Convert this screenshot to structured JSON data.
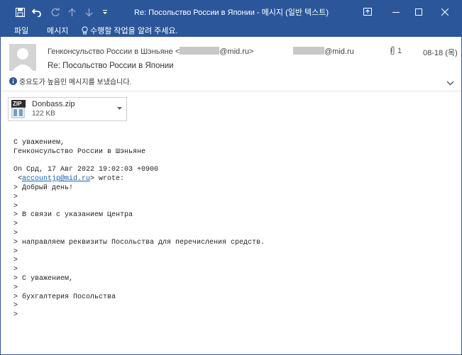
{
  "window": {
    "title": "Re: Посольство России в Японии - 메시지 (일반 텍스트)"
  },
  "menu": {
    "file": "파일",
    "message": "메시지",
    "tell_me": "수행할 작업을 알려 주세요."
  },
  "header": {
    "sender_name": "Генконсульство России в Шэньяне",
    "sender_addr_open": "<",
    "sender_addr_domain": "@mid.ru>",
    "recipient_domain": "@mid.ru",
    "attachment_count": "1",
    "date": "08-18 (목)",
    "subject": "Re: Посольство России в Японии",
    "importance_note": "중요도가 높음인 메시지를 보냈습니다."
  },
  "attachment": {
    "type_label": "ZIP",
    "name": "Donbass.zip",
    "size": "122 KB"
  },
  "body": {
    "signoff": "С уважением,",
    "sender_sig": "Генконсульство России в Шэньяне",
    "on_line": "On Срд, 17 Авг 2022 19:02:03 +0900",
    "quote_addr_pre": " <",
    "quote_addr": "accountjp@mid.ru",
    "quote_addr_post": "> wrote:",
    "quoted_lines": [
      "> Добрый день!",
      ">",
      ">",
      "> В связи с указанием Центра",
      ">",
      ">",
      "> направляем реквизиты Посольства для перечисления средств.",
      ">",
      ">",
      ">",
      "> С уважением,",
      ">",
      "> бухгалтерия Посольства",
      ">",
      ">"
    ]
  },
  "colors": {
    "titlebar": "#2b579a",
    "link": "#1a5fb4",
    "info_icon": "#2b579a"
  }
}
